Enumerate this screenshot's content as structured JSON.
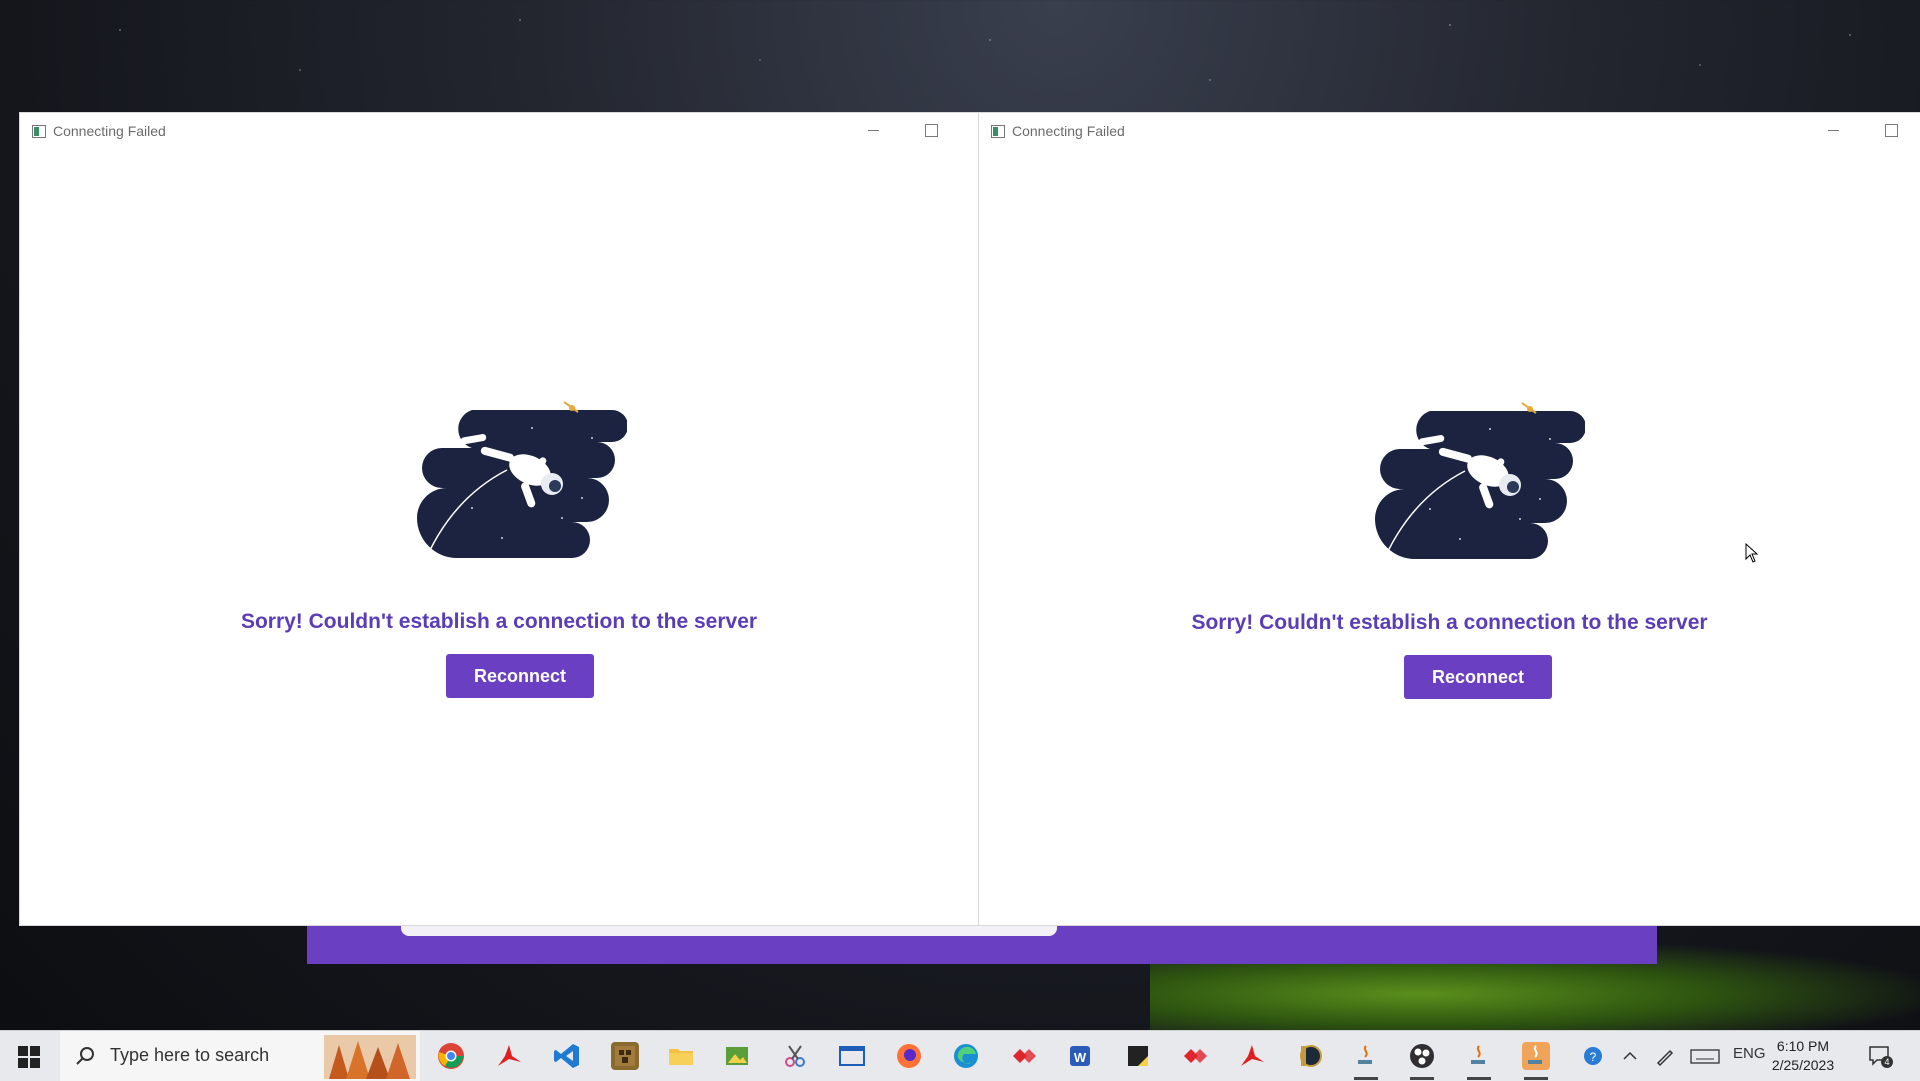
{
  "windows": [
    {
      "title": "Connecting Failed",
      "message": "Sorry! Couldn't establish a connection to the server",
      "button_label": "Reconnect"
    },
    {
      "title": "Connecting Failed",
      "message": "Sorry! Couldn't establish a connection to the server",
      "button_label": "Reconnect"
    }
  ],
  "taskbar": {
    "search_placeholder": "Type here to search",
    "apps": [
      "chrome-icon",
      "acrobat-icon",
      "vscode-icon",
      "minecraft-icon",
      "file-explorer-icon",
      "photos-icon",
      "snipping-tool-icon",
      "window-icon",
      "firefox-icon",
      "edge-icon",
      "anydesk-icon",
      "word-icon",
      "sticky-notes-icon",
      "anydesk-icon",
      "acrobat-icon",
      "league-icon",
      "java-icon",
      "obs-icon",
      "java-icon",
      "java-icon"
    ],
    "language": "ENG",
    "time": "6:10 PM",
    "date": "2/25/2023",
    "notification_count": "4"
  },
  "colors": {
    "accent": "#6a3fc1",
    "message": "#5b3db8",
    "illustration": "#1b2340"
  }
}
